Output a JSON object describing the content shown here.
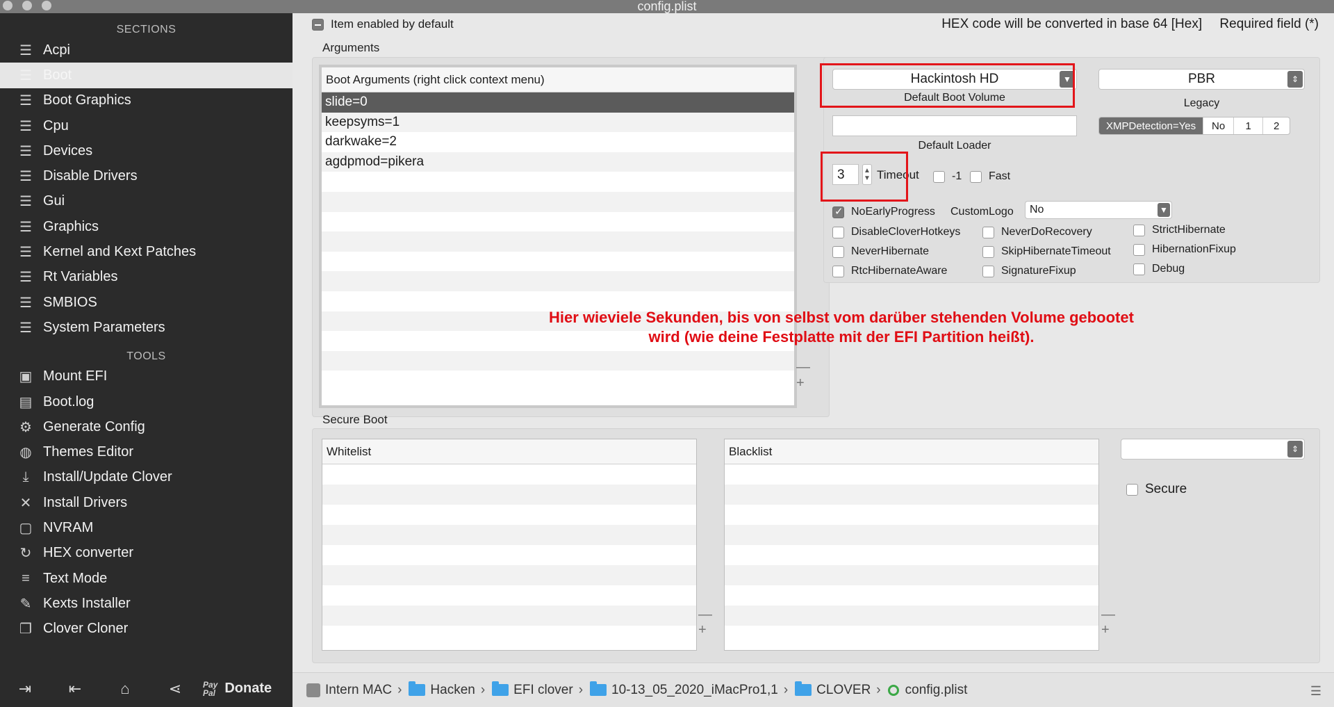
{
  "window": {
    "title": "config.plist"
  },
  "sidebar": {
    "sections_header": "SECTIONS",
    "sections": [
      {
        "label": "Acpi",
        "icon": "list-icon"
      },
      {
        "label": "Boot",
        "icon": "list-icon",
        "active": true
      },
      {
        "label": "Boot Graphics",
        "icon": "list-icon"
      },
      {
        "label": "Cpu",
        "icon": "list-icon"
      },
      {
        "label": "Devices",
        "icon": "list-icon"
      },
      {
        "label": "Disable Drivers",
        "icon": "list-icon"
      },
      {
        "label": "Gui",
        "icon": "list-icon"
      },
      {
        "label": "Graphics",
        "icon": "list-icon"
      },
      {
        "label": "Kernel and Kext Patches",
        "icon": "list-icon"
      },
      {
        "label": "Rt Variables",
        "icon": "list-icon"
      },
      {
        "label": "SMBIOS",
        "icon": "list-icon"
      },
      {
        "label": "System Parameters",
        "icon": "list-icon"
      }
    ],
    "tools_header": "TOOLS",
    "tools": [
      {
        "label": "Mount EFI",
        "icon": "disk-icon"
      },
      {
        "label": "Boot.log",
        "icon": "log-icon"
      },
      {
        "label": "Generate Config",
        "icon": "gears-icon"
      },
      {
        "label": "Themes Editor",
        "icon": "palette-icon"
      },
      {
        "label": "Install/Update Clover",
        "icon": "download-icon"
      },
      {
        "label": "Install Drivers",
        "icon": "tools-icon"
      },
      {
        "label": "NVRAM",
        "icon": "chip-icon"
      },
      {
        "label": "HEX converter",
        "icon": "refresh-icon"
      },
      {
        "label": "Text Mode",
        "icon": "text-icon"
      },
      {
        "label": "Kexts Installer",
        "icon": "plug-icon"
      },
      {
        "label": "Clover Cloner",
        "icon": "clone-icon"
      }
    ],
    "bottom": {
      "donate_label": "Donate",
      "paypal_line1": "Pay",
      "paypal_line2": "Pal"
    }
  },
  "main": {
    "item_enabled_label": "Item enabled by default",
    "hex_note": "HEX code will be converted in base 64 [Hex]",
    "required_note": "Required field (*)",
    "arguments": {
      "group_label": "Arguments",
      "table_header": "Boot Arguments (right click context menu)",
      "rows": [
        "slide=0",
        "keepsyms=1",
        "darkwake=2",
        "agdpmod=pikera"
      ],
      "plus": "+",
      "minus": "—"
    },
    "boot": {
      "default_volume_value": "Hackintosh HD",
      "default_volume_label": "Default Boot Volume",
      "legacy_value": "PBR",
      "legacy_label": "Legacy",
      "default_loader_value": "",
      "default_loader_label": "Default Loader",
      "xmp_segments": [
        "XMPDetection=Yes",
        "No",
        "1",
        "2"
      ],
      "timeout_value": "3",
      "timeout_label": "Timeout",
      "minus_one_label": "-1",
      "fast_label": "Fast",
      "no_early_progress_label": "NoEarlyProgress",
      "custom_logo_label": "CustomLogo",
      "custom_logo_value": "No",
      "options": [
        {
          "label": "DisableCloverHotkeys",
          "checked": false
        },
        {
          "label": "NeverDoRecovery",
          "checked": false
        },
        {
          "label": "StrictHibernate",
          "checked": false
        },
        {
          "label": "NeverHibernate",
          "checked": false
        },
        {
          "label": "SkipHibernateTimeout",
          "checked": false
        },
        {
          "label": "HibernationFixup",
          "checked": false
        },
        {
          "label": "RtcHibernateAware",
          "checked": false
        },
        {
          "label": "SignatureFixup",
          "checked": false
        },
        {
          "label": "Debug",
          "checked": false
        }
      ]
    },
    "annotation_line1": "Hier wieviele Sekunden, bis von selbst vom darüber stehenden Volume gebootet",
    "annotation_line2": "wird (wie deine Festplatte mit der EFI Partition heißt).",
    "secure_boot": {
      "group_label": "Secure Boot",
      "whitelist_header": "Whitelist",
      "blacklist_header": "Blacklist",
      "policy_value": "",
      "secure_label": "Secure"
    }
  },
  "pathbar": {
    "crumbs": [
      "Intern MAC",
      "Hacken",
      "EFI clover",
      "10-13_05_2020_iMacPro1,1",
      "CLOVER",
      "config.plist"
    ],
    "separator": "›"
  },
  "colors": {
    "annotation_red": "#e3151a",
    "sidebar_bg": "#2b2b2b",
    "folder_blue": "#3fa2e8"
  }
}
